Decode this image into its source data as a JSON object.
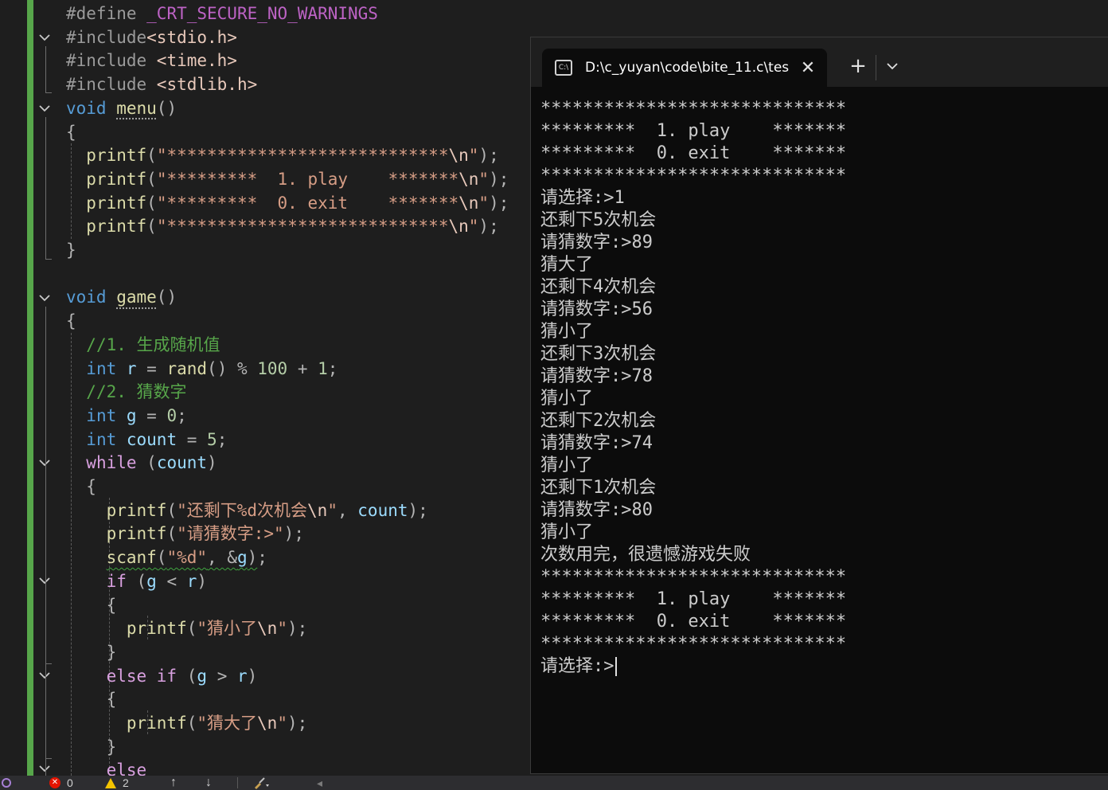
{
  "editor": {
    "lines": [
      [
        [
          "t-pp",
          "#define "
        ],
        [
          "t-mac",
          "_CRT_SECURE_NO_WARNINGS"
        ]
      ],
      [
        [
          "t-pp",
          "#include"
        ],
        [
          "t-inc",
          "<stdio.h>"
        ]
      ],
      [
        [
          "t-pp",
          "#include "
        ],
        [
          "t-inc",
          "<time.h>"
        ]
      ],
      [
        [
          "t-pp",
          "#include "
        ],
        [
          "t-inc",
          "<stdlib.h>"
        ]
      ],
      [
        [
          "t-kw",
          "void "
        ],
        [
          "t-fn dots",
          "menu"
        ],
        [
          "t-pun",
          "()"
        ]
      ],
      [
        [
          "t-pun",
          "{"
        ]
      ],
      [
        [
          "t-def",
          "  "
        ],
        [
          "t-fn",
          "printf"
        ],
        [
          "t-pun",
          "("
        ],
        [
          "t-str",
          "\"****************************"
        ],
        [
          "t-esc",
          "\\n"
        ],
        [
          "t-str",
          "\""
        ],
        [
          "t-pun",
          ");"
        ]
      ],
      [
        [
          "t-def",
          "  "
        ],
        [
          "t-fn",
          "printf"
        ],
        [
          "t-pun",
          "("
        ],
        [
          "t-str",
          "\"*********  1. play    *******"
        ],
        [
          "t-esc",
          "\\n"
        ],
        [
          "t-str",
          "\""
        ],
        [
          "t-pun",
          ");"
        ]
      ],
      [
        [
          "t-def",
          "  "
        ],
        [
          "t-fn",
          "printf"
        ],
        [
          "t-pun",
          "("
        ],
        [
          "t-str",
          "\"*********  0. exit    *******"
        ],
        [
          "t-esc",
          "\\n"
        ],
        [
          "t-str",
          "\""
        ],
        [
          "t-pun",
          ");"
        ]
      ],
      [
        [
          "t-def",
          "  "
        ],
        [
          "t-fn",
          "printf"
        ],
        [
          "t-pun",
          "("
        ],
        [
          "t-str",
          "\"****************************"
        ],
        [
          "t-esc",
          "\\n"
        ],
        [
          "t-str",
          "\""
        ],
        [
          "t-pun",
          ");"
        ]
      ],
      [
        [
          "t-pun",
          "}"
        ]
      ],
      [
        [
          "t-def",
          " "
        ]
      ],
      [
        [
          "t-kw",
          "void "
        ],
        [
          "t-fn dots",
          "game"
        ],
        [
          "t-pun",
          "()"
        ]
      ],
      [
        [
          "t-pun",
          "{"
        ]
      ],
      [
        [
          "t-def",
          "  "
        ],
        [
          "t-com",
          "//1. 生成随机值"
        ]
      ],
      [
        [
          "t-def",
          "  "
        ],
        [
          "t-kw",
          "int "
        ],
        [
          "t-var",
          "r"
        ],
        [
          "t-pun",
          " = "
        ],
        [
          "t-fn",
          "rand"
        ],
        [
          "t-pun",
          "() % "
        ],
        [
          "t-num",
          "100"
        ],
        [
          "t-pun",
          " + "
        ],
        [
          "t-num",
          "1"
        ],
        [
          "t-pun",
          ";"
        ]
      ],
      [
        [
          "t-def",
          "  "
        ],
        [
          "t-com",
          "//2. 猜数字"
        ]
      ],
      [
        [
          "t-def",
          "  "
        ],
        [
          "t-kw",
          "int "
        ],
        [
          "t-var",
          "g"
        ],
        [
          "t-pun",
          " = "
        ],
        [
          "t-num",
          "0"
        ],
        [
          "t-pun",
          ";"
        ]
      ],
      [
        [
          "t-def",
          "  "
        ],
        [
          "t-kw",
          "int "
        ],
        [
          "t-var",
          "count"
        ],
        [
          "t-pun",
          " = "
        ],
        [
          "t-num",
          "5"
        ],
        [
          "t-pun",
          ";"
        ]
      ],
      [
        [
          "t-def",
          "  "
        ],
        [
          "t-ctl",
          "while "
        ],
        [
          "t-pun",
          "("
        ],
        [
          "t-var",
          "count"
        ],
        [
          "t-pun",
          ")"
        ]
      ],
      [
        [
          "t-def",
          "  "
        ],
        [
          "t-pun",
          "{"
        ]
      ],
      [
        [
          "t-def",
          "    "
        ],
        [
          "t-fn",
          "printf"
        ],
        [
          "t-pun",
          "("
        ],
        [
          "t-str",
          "\"还剩下%d次机会"
        ],
        [
          "t-esc",
          "\\n"
        ],
        [
          "t-str",
          "\""
        ],
        [
          "t-pun",
          ", "
        ],
        [
          "t-var",
          "count"
        ],
        [
          "t-pun",
          ");"
        ]
      ],
      [
        [
          "t-def",
          "    "
        ],
        [
          "t-fn",
          "printf"
        ],
        [
          "t-pun",
          "("
        ],
        [
          "t-str",
          "\"请猜数字:>\""
        ],
        [
          "t-pun",
          ");"
        ]
      ],
      [
        [
          "t-def",
          "    "
        ],
        [
          "t-fn squig",
          "scanf"
        ],
        [
          "t-pun squig",
          "("
        ],
        [
          "t-str squig",
          "\"%d\""
        ],
        [
          "t-pun squig",
          ", &"
        ],
        [
          "t-var squig",
          "g"
        ],
        [
          "t-pun squig",
          ")"
        ],
        [
          "t-pun",
          ";"
        ]
      ],
      [
        [
          "t-def",
          "    "
        ],
        [
          "t-ctl",
          "if "
        ],
        [
          "t-pun",
          "("
        ],
        [
          "t-var",
          "g"
        ],
        [
          "t-pun",
          " < "
        ],
        [
          "t-var",
          "r"
        ],
        [
          "t-pun",
          ")"
        ]
      ],
      [
        [
          "t-def",
          "    "
        ],
        [
          "t-pun",
          "{"
        ]
      ],
      [
        [
          "t-def",
          "      "
        ],
        [
          "t-fn",
          "printf"
        ],
        [
          "t-pun",
          "("
        ],
        [
          "t-str",
          "\"猜小了"
        ],
        [
          "t-esc",
          "\\n"
        ],
        [
          "t-str",
          "\""
        ],
        [
          "t-pun",
          ");"
        ]
      ],
      [
        [
          "t-def",
          "    "
        ],
        [
          "t-pun",
          "}"
        ]
      ],
      [
        [
          "t-def",
          "    "
        ],
        [
          "t-ctl",
          "else if "
        ],
        [
          "t-pun",
          "("
        ],
        [
          "t-var",
          "g"
        ],
        [
          "t-pun",
          " > "
        ],
        [
          "t-var",
          "r"
        ],
        [
          "t-pun",
          ")"
        ]
      ],
      [
        [
          "t-def",
          "    "
        ],
        [
          "t-pun",
          "{"
        ]
      ],
      [
        [
          "t-def",
          "      "
        ],
        [
          "t-fn",
          "printf"
        ],
        [
          "t-pun",
          "("
        ],
        [
          "t-str",
          "\"猜大了"
        ],
        [
          "t-esc",
          "\\n"
        ],
        [
          "t-str",
          "\""
        ],
        [
          "t-pun",
          ");"
        ]
      ],
      [
        [
          "t-def",
          "    "
        ],
        [
          "t-pun",
          "}"
        ]
      ],
      [
        [
          "t-def",
          "    "
        ],
        [
          "t-ctl",
          "else"
        ]
      ]
    ]
  },
  "terminal": {
    "tab_title": "D:\\c_yuyan\\code\\bite_11.c\\tes",
    "tab_icon_text": "C:\\",
    "close_glyph": "✕",
    "new_tab_glyph": "+",
    "lines": [
      "*****************************",
      "*********  1. play    *******",
      "*********  0. exit    *******",
      "*****************************",
      "请选择:>1",
      "还剩下5次机会",
      "请猜数字:>89",
      "猜大了",
      "还剩下4次机会",
      "请猜数字:>56",
      "猜小了",
      "还剩下3次机会",
      "请猜数字:>78",
      "猜小了",
      "还剩下2次机会",
      "请猜数字:>74",
      "猜小了",
      "还剩下1次机会",
      "请猜数字:>80",
      "猜小了",
      "次数用完，很遗憾游戏失败",
      "*****************************",
      "*********  1. play    *******",
      "*********  0. exit    *******",
      "*****************************",
      "请选择:>"
    ]
  },
  "statusbar": {
    "errors": "0",
    "warnings": "2",
    "error_icon": "✕",
    "up_arrow": "↑",
    "down_arrow": "↓",
    "left_arrow": "◂"
  }
}
